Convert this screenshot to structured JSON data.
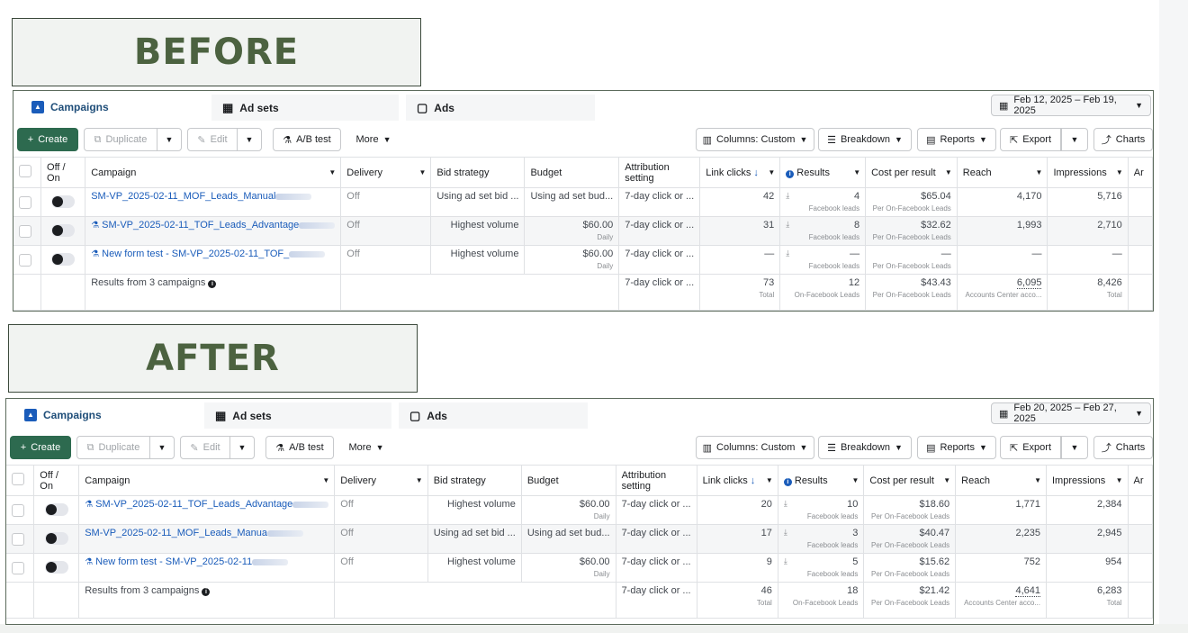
{
  "labels": {
    "before": "BEFORE",
    "after": "AFTER"
  },
  "tabs": {
    "campaigns": "Campaigns",
    "adsets": "Ad sets",
    "ads": "Ads"
  },
  "toolbar": {
    "create": "Create",
    "duplicate": "Duplicate",
    "edit": "Edit",
    "ab_test": "A/B test",
    "more": "More",
    "columns": "Columns: Custom",
    "breakdown": "Breakdown",
    "reports": "Reports",
    "export": "Export",
    "charts": "Charts"
  },
  "headers": {
    "off_on": "Off / On",
    "campaign": "Campaign",
    "delivery": "Delivery",
    "bid_strategy": "Bid strategy",
    "budget": "Budget",
    "attribution": "Attribution setting",
    "link_clicks": "Link clicks",
    "results": "Results",
    "cost_per_result": "Cost per result",
    "reach": "Reach",
    "impressions": "Impressions",
    "amount_spent": "Ar"
  },
  "icons": {
    "sort": "arrow-down-icon",
    "info": "info-icon",
    "download": "download-icon"
  },
  "colors": {
    "accent_green": "#2d6a4f",
    "link_blue": "#1a5cba",
    "label_green": "#4c6240"
  },
  "before": {
    "date_range": "Feb 12, 2025 – Feb 19, 2025",
    "rows": [
      {
        "campaign": "SM-VP_2025-02-11_MOF_Leads_Manual",
        "flask": false,
        "delivery": "Off",
        "bid": "Using ad set bid ...",
        "budget": "Using ad set bud...",
        "budget_sub": "",
        "attribution": "7-day click or ...",
        "clicks": "42",
        "results": "4",
        "results_sub": "Facebook leads",
        "cost": "$65.04",
        "cost_sub": "Per On-Facebook Leads",
        "reach": "4,170",
        "impressions": "5,716"
      },
      {
        "campaign": "SM-VP_2025-02-11_TOF_Leads_Advantage",
        "flask": true,
        "delivery": "Off",
        "bid": "Highest volume",
        "budget": "$60.00",
        "budget_sub": "Daily",
        "attribution": "7-day click or ...",
        "clicks": "31",
        "results": "8",
        "results_sub": "Facebook leads",
        "cost": "$32.62",
        "cost_sub": "Per On-Facebook Leads",
        "reach": "1,993",
        "impressions": "2,710"
      },
      {
        "campaign": "New form test - SM-VP_2025-02-11_TOF_",
        "flask": true,
        "delivery": "Off",
        "bid": "Highest volume",
        "budget": "$60.00",
        "budget_sub": "Daily",
        "attribution": "7-day click or ...",
        "clicks": "—",
        "results": "—",
        "results_sub": "Facebook leads",
        "cost": "—",
        "cost_sub": "Per On-Facebook Leads",
        "reach": "—",
        "impressions": "—"
      }
    ],
    "total": {
      "label": "Results from 3 campaigns",
      "attribution": "7-day click or ...",
      "clicks": "73",
      "clicks_sub": "Total",
      "results": "12",
      "results_sub": "On-Facebook Leads",
      "cost": "$43.43",
      "cost_sub": "Per On-Facebook Leads",
      "reach": "6,095",
      "reach_sub": "Accounts Center acco...",
      "impressions": "8,426",
      "impressions_sub": "Total"
    }
  },
  "after": {
    "date_range": "Feb 20, 2025 – Feb 27, 2025",
    "rows": [
      {
        "campaign": "SM-VP_2025-02-11_TOF_Leads_Advantage",
        "flask": true,
        "delivery": "Off",
        "bid": "Highest volume",
        "budget": "$60.00",
        "budget_sub": "Daily",
        "attribution": "7-day click or ...",
        "clicks": "20",
        "results": "10",
        "results_sub": "Facebook leads",
        "cost": "$18.60",
        "cost_sub": "Per On-Facebook Leads",
        "reach": "1,771",
        "impressions": "2,384"
      },
      {
        "campaign": "SM-VP_2025-02-11_MOF_Leads_Manua",
        "flask": false,
        "delivery": "Off",
        "bid": "Using ad set bid ...",
        "budget": "Using ad set bud...",
        "budget_sub": "",
        "attribution": "7-day click or ...",
        "clicks": "17",
        "results": "3",
        "results_sub": "Facebook leads",
        "cost": "$40.47",
        "cost_sub": "Per On-Facebook Leads",
        "reach": "2,235",
        "impressions": "2,945"
      },
      {
        "campaign": "New form test - SM-VP_2025-02-11",
        "flask": true,
        "delivery": "Off",
        "bid": "Highest volume",
        "budget": "$60.00",
        "budget_sub": "Daily",
        "attribution": "7-day click or ...",
        "clicks": "9",
        "results": "5",
        "results_sub": "Facebook leads",
        "cost": "$15.62",
        "cost_sub": "Per On-Facebook Leads",
        "reach": "752",
        "impressions": "954"
      }
    ],
    "total": {
      "label": "Results from 3 campaigns",
      "attribution": "7-day click or ...",
      "clicks": "46",
      "clicks_sub": "Total",
      "results": "18",
      "results_sub": "On-Facebook Leads",
      "cost": "$21.42",
      "cost_sub": "Per On-Facebook Leads",
      "reach": "4,641",
      "reach_sub": "Accounts Center acco...",
      "impressions": "6,283",
      "impressions_sub": "Total"
    }
  }
}
